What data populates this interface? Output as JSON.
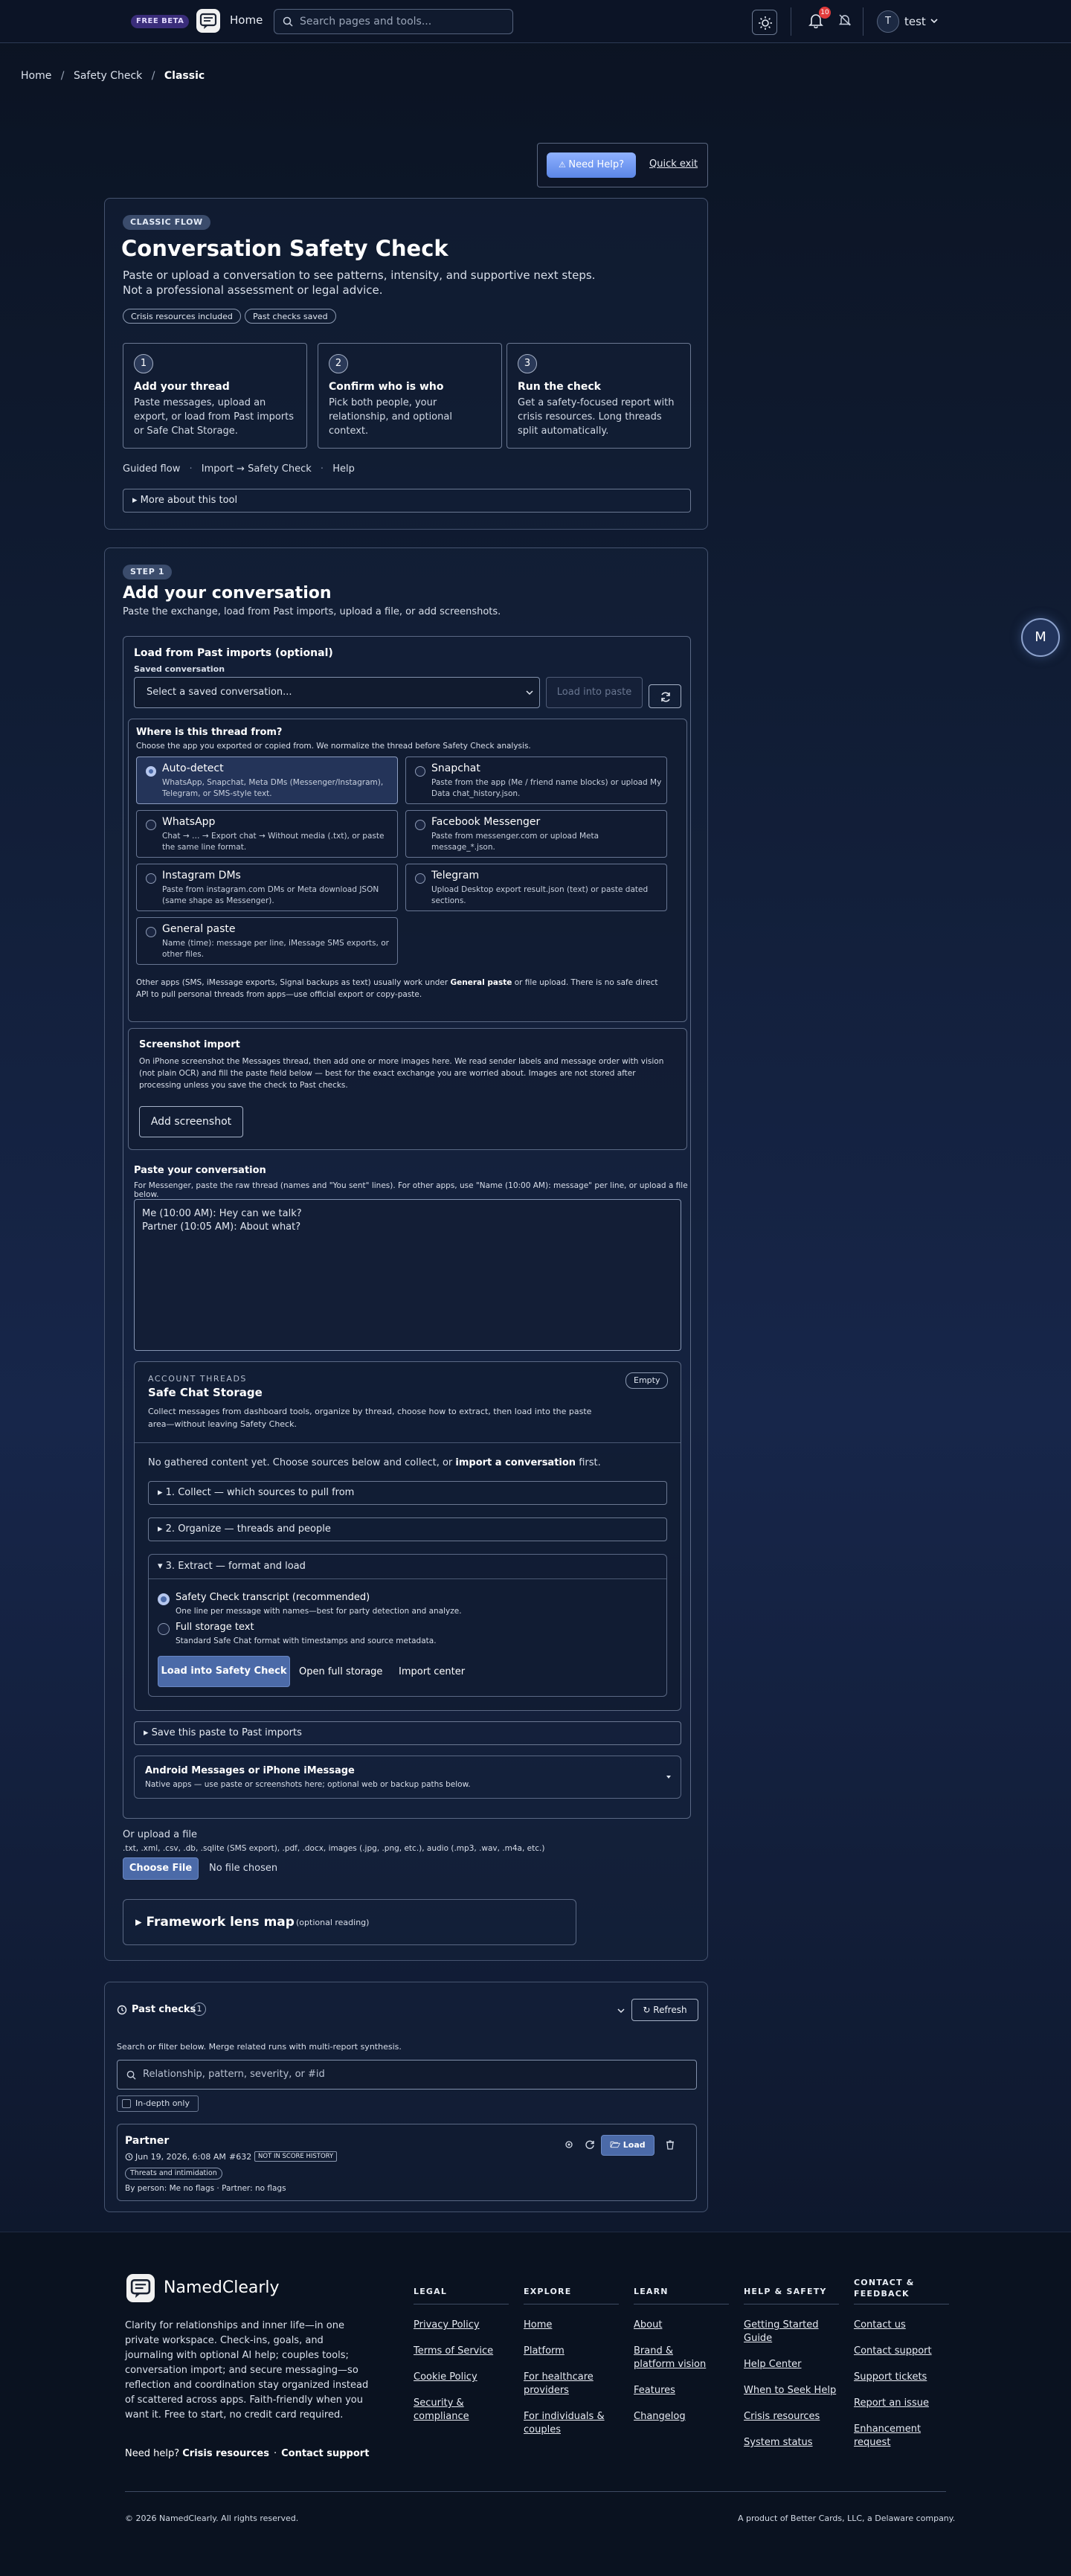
{
  "topbar": {
    "beta": "FREE BETA",
    "home": "Home",
    "search_placeholder": "Search pages and tools...",
    "notifications": "10",
    "avatar": "T",
    "username": "test"
  },
  "breadcrumb": [
    "Home",
    "Safety Check",
    "Classic"
  ],
  "help": {
    "need_help": "Need Help?",
    "quick_exit": "Quick exit"
  },
  "intro": {
    "badge": "CLASSIC FLOW",
    "title": "Conversation Safety Check",
    "subtitle1": "Paste or upload a conversation to see patterns, intensity, and supportive next steps.",
    "subtitle2": "Not a professional assessment or legal advice.",
    "tags": [
      "Crisis resources included",
      "Past checks saved"
    ],
    "steps": [
      {
        "num": "1",
        "title": "Add your thread",
        "desc": "Paste messages, upload an export, or load from Past imports or Safe Chat Storage."
      },
      {
        "num": "2",
        "title": "Confirm who is who",
        "desc": "Pick both people, your relationship, and optional context."
      },
      {
        "num": "3",
        "title": "Run the check",
        "desc": "Get a safety-focused report with crisis resources. Long threads split automatically."
      }
    ],
    "links": [
      "Guided flow",
      "Import → Safety Check",
      "Help"
    ],
    "more": "▸ More about this tool"
  },
  "step1": {
    "badge": "STEP 1",
    "title": "Add your conversation",
    "subtitle": "Paste the exchange, load from Past imports, upload a file, or add screenshots.",
    "past_title": "Load from Past imports (optional)",
    "saved_label": "Saved conversation",
    "saved_placeholder": "Select a saved conversation...",
    "load_btn": "Load into paste",
    "source": {
      "title": "Where is this thread from?",
      "desc": "Choose the app you exported or copied from. We normalize the thread before Safety Check analysis.",
      "options": [
        {
          "title": "Auto-detect",
          "desc": "WhatsApp, Snapchat, Meta DMs (Messenger/Instagram), Telegram, or SMS-style text."
        },
        {
          "title": "Snapchat",
          "desc": "Paste from the app (Me / friend name blocks) or upload My Data chat_history.json."
        },
        {
          "title": "WhatsApp",
          "desc": "Chat → … → Export chat → Without media (.txt), or paste the same line format."
        },
        {
          "title": "Facebook Messenger",
          "desc": "Paste from messenger.com or upload Meta message_*.json."
        },
        {
          "title": "Instagram DMs",
          "desc": "Paste from instagram.com DMs or Meta download JSON (same shape as Messenger)."
        },
        {
          "title": "Telegram",
          "desc": "Upload Desktop export result.json (text) or paste dated sections."
        },
        {
          "title": "General paste",
          "desc": "Name (time): message per line, iMessage SMS exports, or other files."
        }
      ],
      "note_pre": "Other apps (SMS, iMessage exports, Signal backups as text) usually work under ",
      "note_bold": "General paste",
      "note_post": " or file upload. There is no safe direct API to pull personal threads from apps—use official export or copy-paste."
    },
    "screenshot": {
      "title": "Screenshot import",
      "desc": "On iPhone screenshot the Messages thread, then add one or more images here. We read sender labels and message order with vision (not plain OCR) and fill the paste field below — best for the exact exchange you are worried about. Images are not stored after processing unless you save the check to Past checks.",
      "button": "Add screenshot"
    },
    "paste": {
      "title": "Paste your conversation",
      "desc": "For Messenger, paste the raw thread (names and \"You sent\" lines). For other apps, use \"Name (10:00 AM): message\" per line, or upload a file below.",
      "value": "Me (10:00 AM): Hey can we talk?\nPartner (10:05 AM): About what?"
    },
    "account": {
      "label": "ACCOUNT THREADS",
      "title": "Safe Chat Storage",
      "status": "Empty",
      "desc": "Collect messages from dashboard tools, organize by thread, choose how to extract, then load into the paste area—without leaving Safety Check.",
      "empty_pre": "No gathered content yet. Choose sources below and collect, or ",
      "empty_link": "import a conversation",
      "empty_post": " first.",
      "collect": "▸ 1. Collect — which sources to pull from",
      "organize": "▸ 2. Organize — threads and people",
      "extract": "▾ 3. Extract — format and load",
      "opt1_title": "Safety Check transcript (recommended)",
      "opt1_desc": "One line per message with names—best for party detection and analyze.",
      "opt2_title": "Full storage text",
      "opt2_desc": "Standard Safe Chat format with timestamps and source metadata.",
      "btn_load": "Load into Safety Check",
      "btn_full": "Open full storage",
      "btn_import": "Import center"
    },
    "save_paste": "▸ Save this paste to Past imports",
    "android": {
      "title": "Android Messages or iPhone iMessage",
      "desc": "Native apps — use paste or screenshots here; optional web or backup paths below."
    },
    "upload": {
      "title": "Or upload a file",
      "formats": ".txt, .xml, .csv, .db, .sqlite (SMS export), .pdf, .docx, images (.jpg, .png, etc.), audio (.mp3, .wav, .m4a, etc.)",
      "choose": "Choose File",
      "no_file": "No file chosen"
    },
    "framework": {
      "title": "▸ Framework lens map",
      "note": "(optional reading)"
    }
  },
  "fab": "M",
  "past_checks": {
    "title": "Past checks",
    "count": "1",
    "refresh": "Refresh",
    "desc": "Search or filter below. Merge related runs with multi-report synthesis.",
    "search_placeholder": "Relationship, pattern, severity, or #id",
    "indepth": "In-depth only",
    "item": {
      "name": "Partner",
      "date": "Jun 19, 2026, 6:08 AM",
      "id": "#632",
      "badge": "NOT IN SCORE HISTORY",
      "tag": "Threats and intimidation",
      "byperson": "By person: Me no flags · Partner: no flags",
      "load": "Load"
    }
  },
  "footer": {
    "brand": "NamedClearly",
    "tagline": "Clarity for relationships and inner life—in one private workspace. Check-ins, goals, and journaling with optional AI help; couples tools; conversation import; and secure messaging—so reflection and coordination stay organized instead of scattered across apps. Faith-friendly when you want it. Free to start, no credit card required.",
    "help_pre": "Need help? ",
    "crisis": "Crisis resources",
    "contact": "Contact support",
    "columns": [
      {
        "title": "LEGAL",
        "links": [
          "Privacy Policy",
          "Terms of Service",
          "Cookie Policy",
          "Security & compliance"
        ]
      },
      {
        "title": "EXPLORE",
        "links": [
          "Home",
          "Platform",
          "For healthcare providers",
          "For individuals & couples"
        ]
      },
      {
        "title": "LEARN",
        "links": [
          "About",
          "Brand & platform vision",
          "Features",
          "Changelog"
        ]
      },
      {
        "title": "HELP & SAFETY",
        "links": [
          "Getting Started Guide",
          "Help Center",
          "When to Seek Help",
          "Crisis resources",
          "System status"
        ]
      },
      {
        "title": "CONTACT & FEEDBACK",
        "links": [
          "Contact us",
          "Contact support",
          "Support tickets",
          "Report an issue",
          "Enhancement request"
        ]
      }
    ],
    "copyright": "© 2026 NamedClearly. All rights reserved.",
    "company": "A product of Better Cards, LLC, a Delaware company."
  }
}
